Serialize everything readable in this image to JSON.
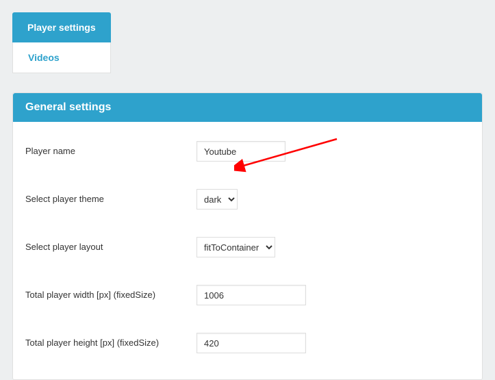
{
  "tabs": {
    "player_settings": "Player settings",
    "videos": "Videos"
  },
  "panel": {
    "header": "General settings",
    "rows": {
      "player_name": {
        "label": "Player name",
        "value": "Youtube"
      },
      "player_theme": {
        "label": "Select player theme",
        "value": "dark"
      },
      "player_layout": {
        "label": "Select player layout",
        "value": "fitToContainer"
      },
      "player_width": {
        "label": "Total player width [px] (fixedSize)",
        "value": "1006"
      },
      "player_height": {
        "label": "Total player height [px] (fixedSize)",
        "value": "420"
      }
    }
  }
}
